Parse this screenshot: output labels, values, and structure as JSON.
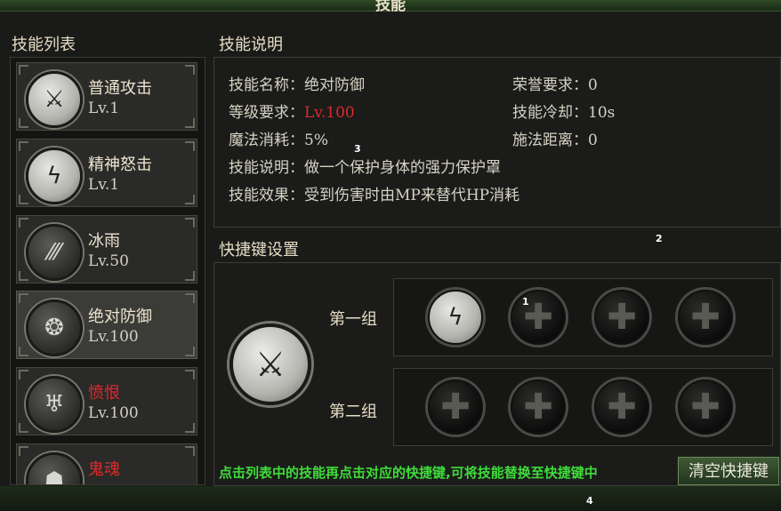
{
  "window": {
    "title": "技能"
  },
  "skill_list": {
    "title": "技能列表",
    "items": [
      {
        "name": "普通攻击",
        "level": "Lv.1",
        "icon": "sword-icon",
        "glyph": "⚔",
        "name_color": "normal",
        "style": "light"
      },
      {
        "name": "精神怒击",
        "level": "Lv.1",
        "icon": "lightning-icon",
        "glyph": "ϟ",
        "name_color": "normal",
        "style": "light"
      },
      {
        "name": "冰雨",
        "level": "Lv.50",
        "icon": "ice-rain-icon",
        "glyph": "⁄⁄⁄",
        "name_color": "normal",
        "style": "dark"
      },
      {
        "name": "绝对防御",
        "level": "Lv.100",
        "icon": "shield-swirl-icon",
        "glyph": "❂",
        "name_color": "normal",
        "style": "dark"
      },
      {
        "name": "愤恨",
        "level": "Lv.100",
        "icon": "rage-icon",
        "glyph": "♅",
        "name_color": "red",
        "style": "dark"
      },
      {
        "name": "鬼魂",
        "level": "",
        "icon": "ghost-icon",
        "glyph": "☗",
        "name_color": "red",
        "style": "dark"
      }
    ],
    "selected_index": 3
  },
  "skill_desc": {
    "title": "技能说明",
    "name_label": "技能名称：",
    "name_value": "绝对防御",
    "level_label": "等级要求：",
    "level_value": "Lv.100",
    "mana_label": "魔法消耗：",
    "mana_value": "5%",
    "desc_label": "技能说明：",
    "desc_value": "做一个保护身体的强力保护罩",
    "effect_label": "技能效果：",
    "effect_value": "受到伤害时由MP来替代HP消耗",
    "honor_label": "荣誉要求：",
    "honor_value": "0",
    "cooldown_label": "技能冷却：",
    "cooldown_value": "10s",
    "range_label": "施法距离：",
    "range_value": "0"
  },
  "shortcut": {
    "title": "快捷键设置",
    "selected_icon": "sword-icon",
    "group1_label": "第一组",
    "group2_label": "第二组",
    "group1_slots": [
      {
        "filled": true,
        "icon": "lightning-icon",
        "glyph": "ϟ"
      },
      {
        "filled": false,
        "icon": "plus-icon",
        "glyph": "✚"
      },
      {
        "filled": false,
        "icon": "plus-icon",
        "glyph": "✚"
      },
      {
        "filled": false,
        "icon": "plus-icon",
        "glyph": "✚"
      }
    ],
    "group2_slots": [
      {
        "filled": false,
        "icon": "plus-icon",
        "glyph": "✚"
      },
      {
        "filled": false,
        "icon": "plus-icon",
        "glyph": "✚"
      },
      {
        "filled": false,
        "icon": "plus-icon",
        "glyph": "✚"
      },
      {
        "filled": false,
        "icon": "plus-icon",
        "glyph": "✚"
      }
    ],
    "hint": "点击列表中的技能再点击对应的快捷键,可将技能替换至快捷键中",
    "clear_button": "清空快捷键"
  },
  "markers": {
    "m1": "1",
    "m2": "2",
    "m3": "3",
    "m4": "4"
  },
  "colors": {
    "accent_red": "#e0292c",
    "hint_green": "#3fdc3a"
  }
}
